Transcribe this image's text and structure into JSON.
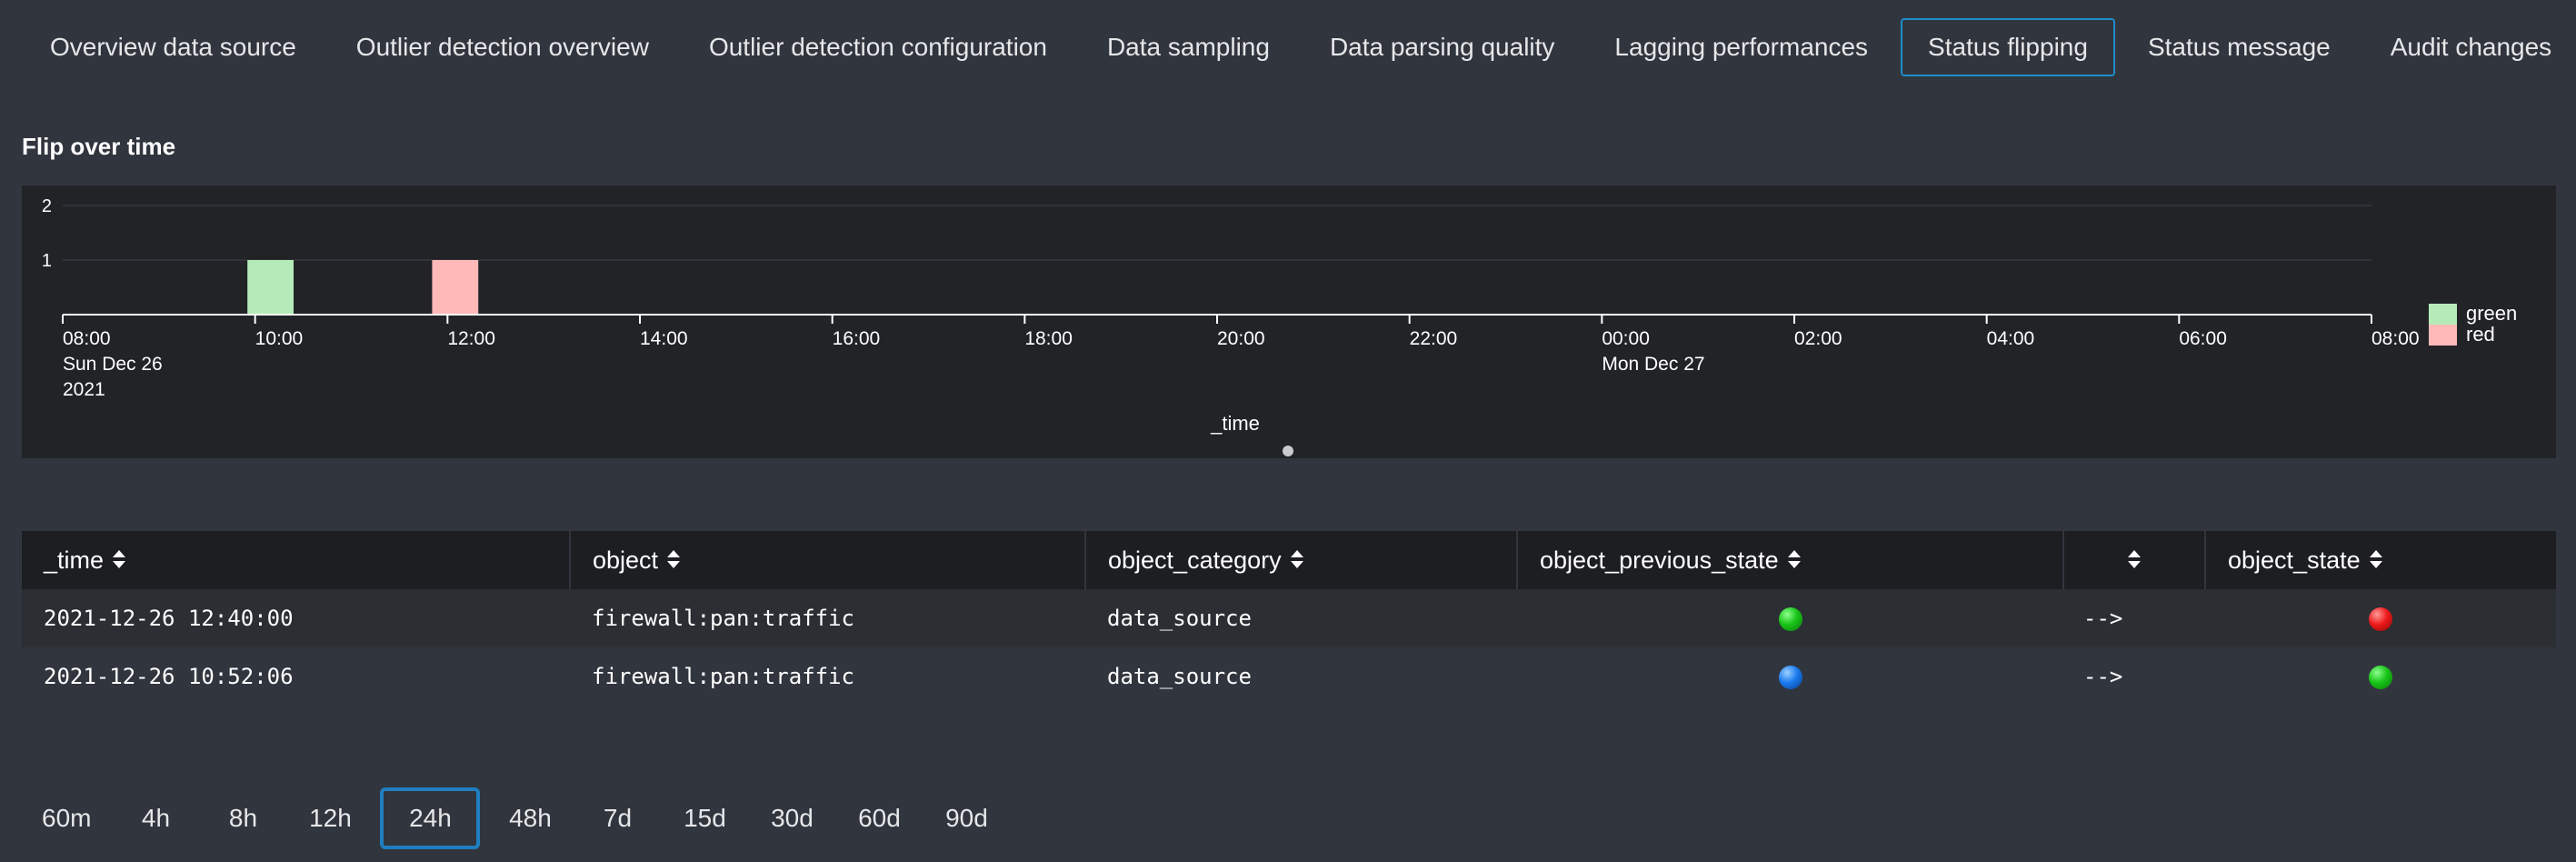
{
  "tabs": [
    {
      "label": "Overview data source",
      "active": false
    },
    {
      "label": "Outlier detection overview",
      "active": false
    },
    {
      "label": "Outlier detection configuration",
      "active": false
    },
    {
      "label": "Data sampling",
      "active": false
    },
    {
      "label": "Data parsing quality",
      "active": false
    },
    {
      "label": "Lagging performances",
      "active": false
    },
    {
      "label": "Status flipping",
      "active": true
    },
    {
      "label": "Status message",
      "active": false
    },
    {
      "label": "Audit changes",
      "active": false
    }
  ],
  "panel": {
    "title": "Flip over time"
  },
  "chart_data": {
    "type": "bar",
    "title": "",
    "xlabel": "_time",
    "ylabel": "",
    "ylim": [
      0,
      2
    ],
    "y_ticks": [
      1,
      2
    ],
    "x_range": [
      "2021-12-26 08:00",
      "2021-12-27 09:00"
    ],
    "x_tick_labels": [
      [
        "08:00",
        "Sun Dec 26",
        "2021"
      ],
      [
        "10:00"
      ],
      [
        "12:00"
      ],
      [
        "14:00"
      ],
      [
        "16:00"
      ],
      [
        "18:00"
      ],
      [
        "20:00"
      ],
      [
        "22:00"
      ],
      [
        "00:00",
        "Mon Dec 27"
      ],
      [
        "02:00"
      ],
      [
        "04:00"
      ],
      [
        "06:00"
      ],
      [
        "08:00"
      ]
    ],
    "series": [
      {
        "name": "green",
        "color": "#b5ebb8",
        "points": [
          {
            "start": "2021-12-26 10:00",
            "end": "2021-12-26 10:30",
            "value": 1
          }
        ]
      },
      {
        "name": "red",
        "color": "#ffb9b9",
        "points": [
          {
            "start": "2021-12-26 12:00",
            "end": "2021-12-26 12:30",
            "value": 1
          }
        ]
      }
    ],
    "legend_position": "right",
    "grid": true
  },
  "table": {
    "columns": [
      {
        "label": "_time",
        "center": false
      },
      {
        "label": "object",
        "center": false
      },
      {
        "label": "object_category",
        "center": false
      },
      {
        "label": "object_previous_state",
        "center": false
      },
      {
        "label": "",
        "center": true
      },
      {
        "label": "object_state",
        "center": false
      }
    ],
    "rows": [
      {
        "time": "2021-12-26 12:40:00",
        "object": "firewall:pan:traffic",
        "category": "data_source",
        "previous_state": "green",
        "arrow": "-->",
        "state": "red"
      },
      {
        "time": "2021-12-26 10:52:06",
        "object": "firewall:pan:traffic",
        "category": "data_source",
        "previous_state": "blue",
        "arrow": "-->",
        "state": "green"
      }
    ]
  },
  "time_ranges": [
    {
      "label": "60m",
      "active": false
    },
    {
      "label": "4h",
      "active": false
    },
    {
      "label": "8h",
      "active": false
    },
    {
      "label": "12h",
      "active": false
    },
    {
      "label": "24h",
      "active": true
    },
    {
      "label": "48h",
      "active": false
    },
    {
      "label": "7d",
      "active": false
    },
    {
      "label": "15d",
      "active": false
    },
    {
      "label": "30d",
      "active": false
    },
    {
      "label": "60d",
      "active": false
    },
    {
      "label": "90d",
      "active": false
    }
  ]
}
